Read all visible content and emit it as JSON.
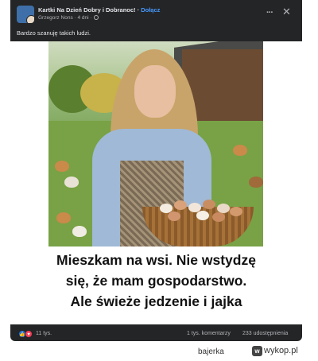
{
  "post": {
    "group_name": "Kartki Na Dzień Dobry i Dobranoc!",
    "separator": " · ",
    "join_label": "Dołącz",
    "author": "Grzegorz Nons",
    "time": "4 dni",
    "text": "Bardzo szanuję takich ludzi.",
    "more_label": "···",
    "close_label": "✕"
  },
  "image": {
    "caption_lines": [
      "Mieszkam na wsi. Nie wstydzę",
      "się, że mam gospodarstwo.",
      "Ale świeże jedzenie i jajka"
    ]
  },
  "footer": {
    "reactions": [
      "like-icon",
      "heart-icon"
    ],
    "reaction_count": "11 tys.",
    "comments": "1 tys. komentarzy",
    "shares": "233 udostępnienia"
  },
  "watermark": {
    "username": "bajerka",
    "site": "wykop.pl"
  },
  "colors": {
    "card_bg": "#242526",
    "link_blue": "#4599ff",
    "text_primary": "#e4e6eb",
    "text_secondary": "#b0b3b8"
  }
}
